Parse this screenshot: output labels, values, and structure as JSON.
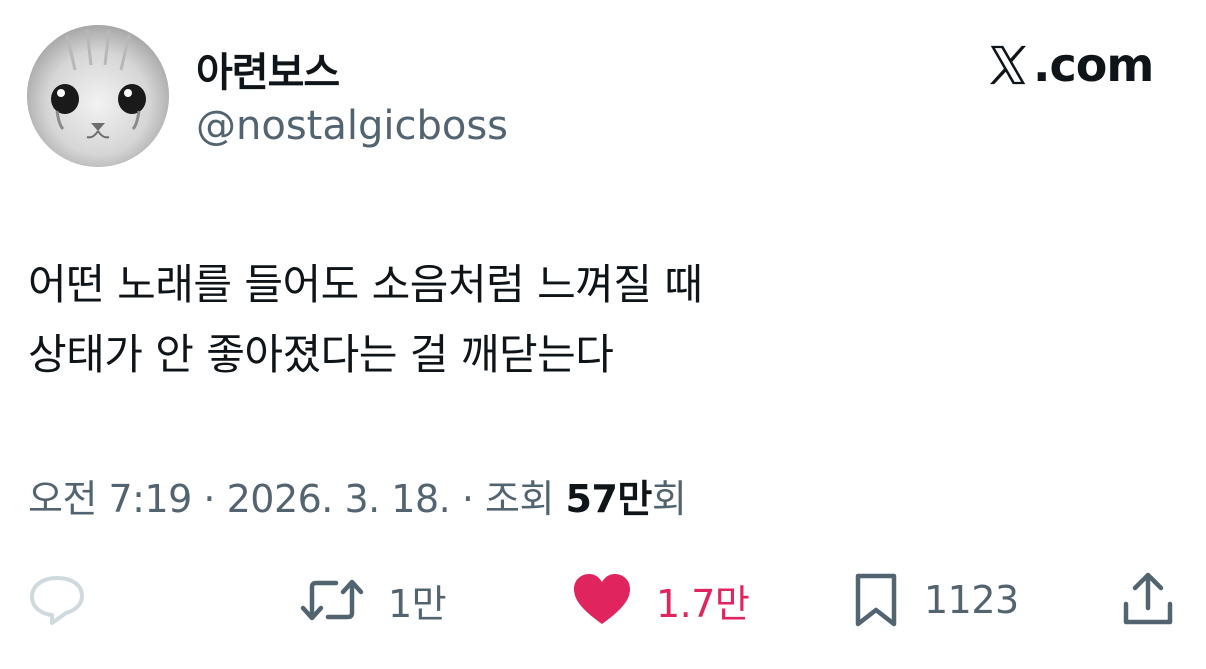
{
  "author": {
    "display_name": "아련보스",
    "handle": "@nostalgicboss",
    "avatar": "crying-cat-avatar"
  },
  "brand": {
    "label": ".com",
    "icon": "x-logo-icon"
  },
  "tweet": {
    "lines": [
      "어떤 노래를 들어도 소음처럼 느껴질 때",
      "상태가 안 좋아졌다는 걸 깨닫는다"
    ]
  },
  "meta": {
    "time": "오전 7:19",
    "separator": " · ",
    "date": "2026. 3. 18.",
    "views_label": "조회",
    "views_count": "57만",
    "views_suffix": "회"
  },
  "actions": {
    "reply": {
      "icon": "reply-icon",
      "count": ""
    },
    "retweet": {
      "icon": "retweet-icon",
      "count": "1만"
    },
    "like": {
      "icon": "heart-icon",
      "count": "1.7만",
      "color": "#e0245e"
    },
    "bookmark": {
      "icon": "bookmark-icon",
      "count": "1123"
    },
    "share": {
      "icon": "share-icon"
    }
  },
  "colors": {
    "text": "#0f1419",
    "secondary": "#536471",
    "like": "#e0245e",
    "reply_icon": "#cfd9de"
  }
}
